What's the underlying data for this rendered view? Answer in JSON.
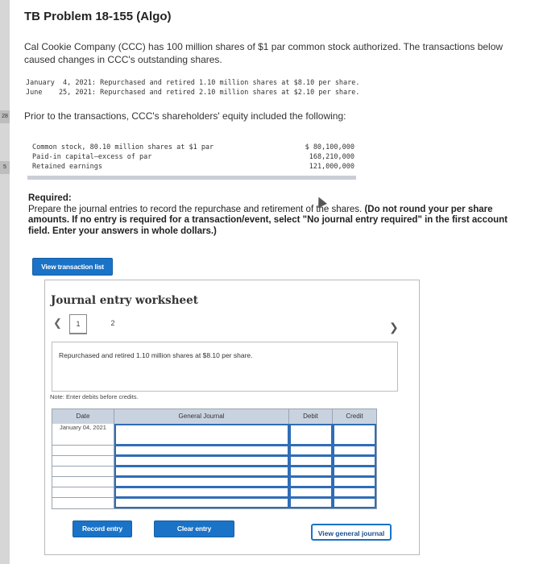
{
  "problem": {
    "title": "TB Problem 18-155 (Algo)",
    "intro": "Cal Cookie Company (CCC) has 100 million shares of $1 par common stock authorized. The transactions below caused changes in CCC's outstanding shares."
  },
  "transactions": [
    {
      "date": "January  4, 2021:",
      "text": "Repurchased and retired 1.10 million shares at $8.10 per share."
    },
    {
      "date": "June    25, 2021:",
      "text": "Repurchased and retired 2.10 million shares at $2.10 per share."
    }
  ],
  "prior_text": "Prior to the transactions, CCC's shareholders' equity included the following:",
  "equity": [
    {
      "label": "Common stock, 80.10 million shares at $1 par",
      "amount": "$ 80,100,000"
    },
    {
      "label": "Paid-in capital—excess of par",
      "amount": "168,210,000"
    },
    {
      "label": "Retained earnings",
      "amount": "121,000,000"
    }
  ],
  "required": {
    "label": "Required:",
    "text": "Prepare the journal entries to record the repurchase and retirement of the shares.",
    "bold_text": "(Do not round your per share amounts. If no entry is required for a transaction/event, select \"No journal entry required\" in the first account field. Enter your answers in whole dollars.)"
  },
  "buttons": {
    "view_transaction_list": "View transaction list",
    "record_entry": "Record entry",
    "clear_entry": "Clear entry",
    "view_general_journal": "View general journal"
  },
  "worksheet": {
    "title": "Journal entry worksheet",
    "tabs": [
      "1",
      "2"
    ],
    "description": "Repurchased and retired 1.10 million shares at $8.10 per share.",
    "note": "Note: Enter debits before credits.",
    "headers": {
      "date": "Date",
      "general_journal": "General Journal",
      "debit": "Debit",
      "credit": "Credit"
    },
    "first_date": "January 04, 2021"
  },
  "side_marks": [
    "28",
    "5"
  ],
  "colors": {
    "accent": "#1a73c7",
    "header_bg": "#c9d3e0",
    "input_border": "#2f6db7"
  }
}
